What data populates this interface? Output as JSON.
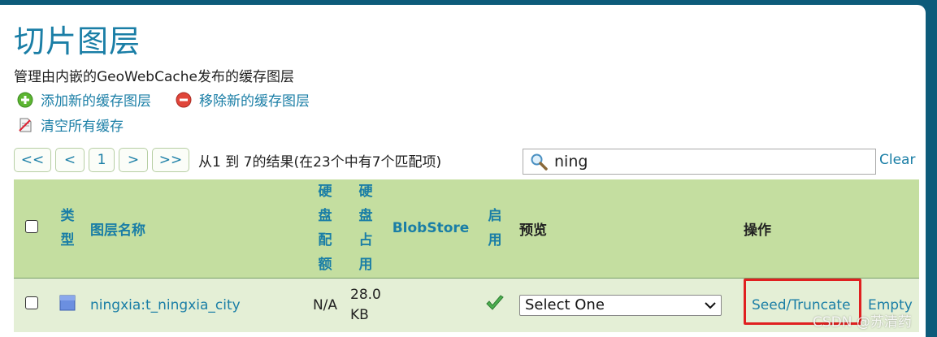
{
  "page": {
    "title": "切片图层",
    "description": "管理由内嵌的GeoWebCache发布的缓存图层"
  },
  "actions": {
    "add_label": "添加新的缓存图层",
    "remove_label": "移除新的缓存图层",
    "clear_label": "清空所有缓存"
  },
  "pager": {
    "first": "<<",
    "prev": "<",
    "page": "1",
    "next": ">",
    "last": ">>",
    "info": "从1 到 7的结果(在23个中有7个匹配项)"
  },
  "search": {
    "value": "ning",
    "clear_label": "Clear"
  },
  "table": {
    "headers": {
      "type": "类型",
      "name": "图层名称",
      "quota": "硬盘配额",
      "used": "硬盘占用",
      "blobstore": "BlobStore",
      "enabled": "启用",
      "preview": "预览",
      "ops": "操作"
    },
    "rows": [
      {
        "name": "ningxia:t_ningxia_city",
        "quota": "N/A",
        "used": "28.0 KB",
        "preview_selected": "Select One",
        "seed_label": "Seed/Truncate",
        "empty_label": "Empty"
      }
    ]
  },
  "watermark": "CSDN @苏清药",
  "colors": {
    "accent": "#1a7ea6",
    "header_bg": "#c4dea0",
    "row_bg": "#e4efd6",
    "highlight": "#e02020",
    "frame": "#0d5b7a"
  },
  "icons": {
    "add": "plus-circle-icon",
    "remove": "minus-circle-icon",
    "clear": "cache-document-icon",
    "search": "magnifier-icon",
    "type": "raster-layer-icon",
    "enabled": "check-icon",
    "select": "chevron-down-icon"
  }
}
